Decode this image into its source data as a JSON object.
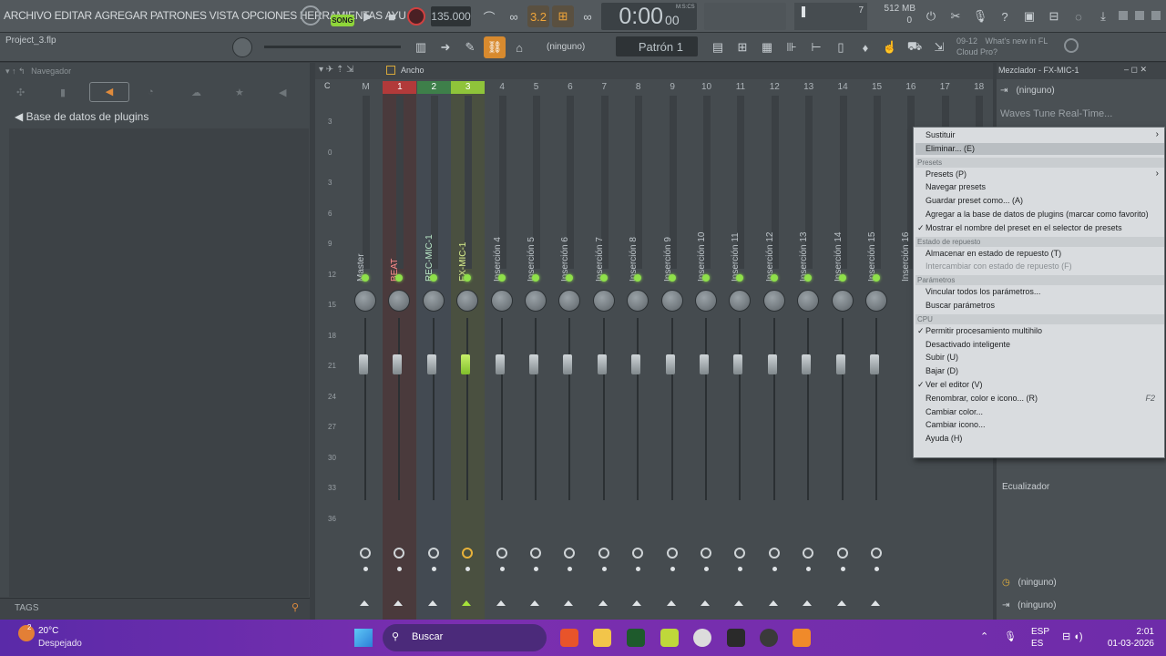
{
  "menu": [
    "ARCHIVO",
    "EDITAR",
    "AGREGAR",
    "PATRONES",
    "VISTA",
    "OPCIONES",
    "HERRAMIENTAS",
    "AYU"
  ],
  "transport": {
    "song_label": "SONG",
    "tempo": "135.000",
    "time": "0:00",
    "time_small": "00",
    "time_unit": "M:S:CS",
    "cpu_value": "7",
    "mem_value": "512 MB",
    "mem_sub": "0",
    "snap_label": "3.2"
  },
  "project": {
    "file": "Project_3.flp",
    "channel_select": "(ninguno)",
    "pattern": "Patrón 1",
    "news_date": "09-12",
    "news_text": "What's new in FL",
    "news_text2": "Cloud Pro?"
  },
  "browser": {
    "title": "Navegador",
    "item": "Base de datos de plugins",
    "tags_label": "TAGS"
  },
  "mixer": {
    "width_label": "Ancho",
    "title": "Mezclador - FX-MIC-1",
    "track_header_c": "C",
    "track_header_m": "M",
    "tracks": [
      {
        "num": "M",
        "name": "Master",
        "color": "#5c6266"
      },
      {
        "num": "1",
        "name": "BEAT",
        "color": "#b23a3a"
      },
      {
        "num": "2",
        "name": "REC-MIC-1",
        "color": "#3e7f4a"
      },
      {
        "num": "3",
        "name": "FX-MIC-1",
        "color": "#8fc43a"
      },
      {
        "num": "4",
        "name": "Inserción 4",
        "color": ""
      },
      {
        "num": "5",
        "name": "Inserción 5",
        "color": ""
      },
      {
        "num": "6",
        "name": "Inserción 6",
        "color": ""
      },
      {
        "num": "7",
        "name": "Inserción 7",
        "color": ""
      },
      {
        "num": "8",
        "name": "Inserción 8",
        "color": ""
      },
      {
        "num": "9",
        "name": "Inserción 9",
        "color": ""
      },
      {
        "num": "10",
        "name": "Inserción 10",
        "color": ""
      },
      {
        "num": "11",
        "name": "Inserción 11",
        "color": ""
      },
      {
        "num": "12",
        "name": "Inserción 12",
        "color": ""
      },
      {
        "num": "13",
        "name": "Inserción 13",
        "color": ""
      },
      {
        "num": "14",
        "name": "Inserción 14",
        "color": ""
      },
      {
        "num": "15",
        "name": "Inserción 15",
        "color": ""
      },
      {
        "num": "16",
        "name": "Inserción 16",
        "color": ""
      },
      {
        "num": "17",
        "name": "",
        "color": ""
      },
      {
        "num": "18",
        "name": "",
        "color": ""
      }
    ],
    "db_scale": [
      "3",
      "0",
      "3",
      "6",
      "9",
      "12",
      "15",
      "18",
      "21",
      "24",
      "27",
      "30",
      "33",
      "36"
    ]
  },
  "fxpanel": {
    "input": "(ninguno)",
    "plugin": "Waves Tune Real-Time...",
    "eq_label": "Ecualizador",
    "out1": "(ninguno)",
    "out2": "(ninguno)"
  },
  "context_menu": {
    "items": [
      {
        "label": "Sustituir",
        "kind": "item",
        "arrow": true
      },
      {
        "label": "Eliminar... (E)",
        "kind": "item",
        "hl": true
      },
      {
        "label": "Presets",
        "kind": "section"
      },
      {
        "label": "Presets (P)",
        "kind": "item",
        "arrow": true
      },
      {
        "label": "Navegar presets",
        "kind": "item"
      },
      {
        "label": "Guardar preset como... (A)",
        "kind": "item"
      },
      {
        "label": "Agregar a la base de datos de plugins (marcar como favorito)",
        "kind": "item"
      },
      {
        "label": "Mostrar el nombre del preset en el selector de presets",
        "kind": "item",
        "check": true
      },
      {
        "label": "Estado de repuesto",
        "kind": "section"
      },
      {
        "label": "Almacenar en estado de repuesto (T)",
        "kind": "item"
      },
      {
        "label": "Intercambiar con estado de repuesto (F)",
        "kind": "item",
        "disabled": true
      },
      {
        "label": "Parámetros",
        "kind": "section"
      },
      {
        "label": "Vincular todos los parámetros...",
        "kind": "item"
      },
      {
        "label": "Buscar parámetros",
        "kind": "item"
      },
      {
        "label": "CPU",
        "kind": "section"
      },
      {
        "label": "Permitir procesamiento multihilo",
        "kind": "item",
        "check": true
      },
      {
        "label": "Desactivado inteligente",
        "kind": "item"
      },
      {
        "label": "Subir (U)",
        "kind": "item"
      },
      {
        "label": "Bajar (D)",
        "kind": "item"
      },
      {
        "label": "Ver el editor (V)",
        "kind": "item",
        "check": true
      },
      {
        "label": "Renombrar, color e icono... (R)",
        "kind": "item",
        "shortcut": "F2"
      },
      {
        "label": "Cambiar color...",
        "kind": "item"
      },
      {
        "label": "Cambiar icono...",
        "kind": "item"
      },
      {
        "label": "Ayuda (H)",
        "kind": "item"
      }
    ]
  },
  "taskbar": {
    "temp": "20°C",
    "weather": "Despejado",
    "search": "Buscar",
    "lang1": "ESP",
    "lang2": "ES",
    "time": "2:01",
    "date": "01-03-2026",
    "weather_badge": "2"
  }
}
